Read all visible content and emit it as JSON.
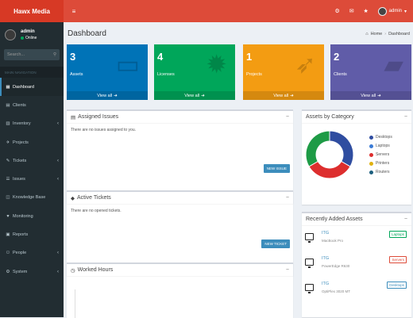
{
  "app": {
    "logo": "Hawx Media"
  },
  "topbar": {
    "hamburger": "≡",
    "icons": [
      "⚙",
      "✉",
      "★"
    ],
    "user": "admin"
  },
  "sidebar": {
    "user": {
      "name": "admin",
      "status": "Online"
    },
    "search_placeholder": "Search...",
    "nav_header": "MAIN NAVIGATION",
    "items": [
      {
        "label": "Dashboard",
        "icon": "▦",
        "active": true,
        "chevron": false
      },
      {
        "label": "Clients",
        "icon": "▤",
        "chevron": false
      },
      {
        "label": "Inventory",
        "icon": "▥",
        "chevron": true
      },
      {
        "label": "Projects",
        "icon": "✈",
        "chevron": false
      },
      {
        "label": "Tickets",
        "icon": "✎",
        "chevron": true
      },
      {
        "label": "Issues",
        "icon": "☰",
        "chevron": true
      },
      {
        "label": "Knowledge Base",
        "icon": "◫",
        "chevron": false
      },
      {
        "label": "Monitoring",
        "icon": "♥",
        "chevron": false
      },
      {
        "label": "Reports",
        "icon": "▣",
        "chevron": false
      },
      {
        "label": "People",
        "icon": "⚇",
        "chevron": true
      },
      {
        "label": "System",
        "icon": "⚙",
        "chevron": true
      }
    ]
  },
  "page": {
    "title": "Dashboard",
    "breadcrumb_home": "Home",
    "breadcrumb_current": "Dashboard"
  },
  "stats": [
    {
      "value": "3",
      "label": "Assets",
      "footer": "View all",
      "color": "#0073b7"
    },
    {
      "value": "4",
      "label": "Licenses",
      "footer": "View all",
      "color": "#00a65a"
    },
    {
      "value": "1",
      "label": "Projects",
      "footer": "View all",
      "color": "#f39c12"
    },
    {
      "value": "2",
      "label": "Clients",
      "footer": "View all",
      "color": "#605ca8"
    }
  ],
  "assigned_issues": {
    "title": "Assigned Issues",
    "empty": "There are no issues assigned to you.",
    "button": "NEW ISSUE"
  },
  "active_tickets": {
    "title": "Active Tickets",
    "empty": "There are no opened tickets.",
    "button": "NEW TICKET"
  },
  "worked_hours": {
    "title": "Worked Hours"
  },
  "assets_by_category": {
    "title": "Assets by Category",
    "legend": [
      {
        "label": "Desktops",
        "color": "#2f4da0"
      },
      {
        "label": "Laptops",
        "color": "#3a7bd5"
      },
      {
        "label": "Servers",
        "color": "#dd2e2e"
      },
      {
        "label": "Printers",
        "color": "#1e9b46"
      },
      {
        "label": "Routers",
        "color": "#1c5f7e"
      }
    ]
  },
  "recent_assets": {
    "title": "Recently Added Assets",
    "items": [
      {
        "name": "ITG",
        "model": "MacBook Pro",
        "tag": "Laptops",
        "tag_color": "#00a65a"
      },
      {
        "name": "ITG",
        "model": "PowerEdge R630",
        "tag": "Servers",
        "tag_color": "#dd4b39"
      },
      {
        "name": "ITG",
        "model": "OptiPlex 3020 MT",
        "tag": "Desktops",
        "tag_color": "#3c8dbc"
      }
    ]
  },
  "chart_data": {
    "type": "pie",
    "title": "Assets by Category",
    "categories": [
      "Desktops",
      "Laptops",
      "Servers",
      "Printers",
      "Routers"
    ],
    "values": [
      1,
      0,
      1,
      1,
      0
    ],
    "colors": [
      "#2f4da0",
      "#3a7bd5",
      "#dd2e2e",
      "#1e9b46",
      "#1c5f7e"
    ],
    "legend_position": "right"
  }
}
